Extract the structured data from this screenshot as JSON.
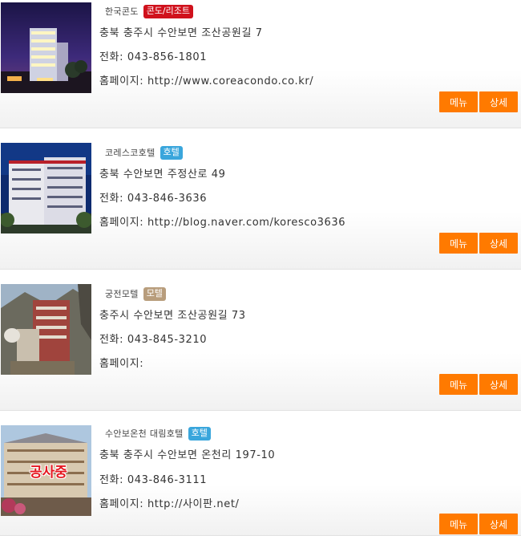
{
  "listings": [
    {
      "name": "한국콘도",
      "badge": "콘도/리조트",
      "badge_color": "#d0111c",
      "address": "충북 충주시 수안보면 조산공원길 7",
      "phone": "전화: 043-856-1801",
      "homepage": "홈페이지: http://www.coreacondo.co.kr/",
      "menu_label": "메뉴",
      "detail_label": "상세"
    },
    {
      "name": "코레스코호텔",
      "badge": "호텔",
      "badge_color": "#3aa6dc",
      "address": "충북 수안보면 주정산로 49",
      "phone": "전화: 043-846-3636",
      "homepage": "홈페이지: http://blog.naver.com/koresco3636",
      "menu_label": "메뉴",
      "detail_label": "상세"
    },
    {
      "name": "궁전모텔",
      "badge": "모텔",
      "badge_color": "#b89d7c",
      "address": "충주시 수안보면 조산공원길 73",
      "phone": "전화: 043-845-3210",
      "homepage": "홈페이지:",
      "menu_label": "메뉴",
      "detail_label": "상세"
    },
    {
      "name": "수안보온천 대림호텔",
      "badge": "호텔",
      "badge_color": "#3aa6dc",
      "address": "충북 충주시 수안보면 온천리 197-10",
      "phone": "전화: 043-846-3111",
      "homepage": "홈페이지: http://사이판.net/",
      "menu_label": "메뉴",
      "detail_label": "상세",
      "photo_text": "공사중"
    }
  ],
  "accent_color": "#ff7a00"
}
